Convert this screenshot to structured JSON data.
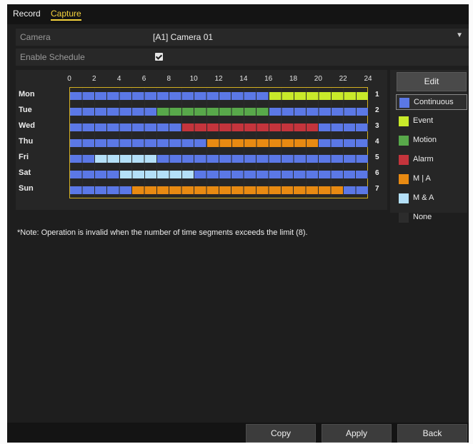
{
  "tabs": [
    {
      "label": "Record",
      "active": false
    },
    {
      "label": "Capture",
      "active": true
    }
  ],
  "camera": {
    "label": "Camera",
    "value": "[A1] Camera 01"
  },
  "enable_schedule": {
    "label": "Enable Schedule",
    "checked": true
  },
  "hours": [
    "0",
    "2",
    "4",
    "6",
    "8",
    "10",
    "12",
    "14",
    "16",
    "18",
    "20",
    "22",
    "24"
  ],
  "colors": {
    "continuous": "#5b78e6",
    "event": "#c8ea2a",
    "motion": "#58a84a",
    "alarm": "#c4343c",
    "mia": "#e88a12",
    "manda": "#b4e0f8",
    "none": "#2c2c2c"
  },
  "days": [
    {
      "name": "Mon",
      "num": "1",
      "segments": [
        {
          "start": 0,
          "end": 16,
          "type": "continuous"
        },
        {
          "start": 16,
          "end": 24,
          "type": "event"
        }
      ]
    },
    {
      "name": "Tue",
      "num": "2",
      "segments": [
        {
          "start": 0,
          "end": 7,
          "type": "continuous"
        },
        {
          "start": 7,
          "end": 16,
          "type": "motion"
        },
        {
          "start": 16,
          "end": 24,
          "type": "continuous"
        }
      ]
    },
    {
      "name": "Wed",
      "num": "3",
      "segments": [
        {
          "start": 0,
          "end": 9,
          "type": "continuous"
        },
        {
          "start": 9,
          "end": 20,
          "type": "alarm"
        },
        {
          "start": 20,
          "end": 24,
          "type": "continuous"
        }
      ]
    },
    {
      "name": "Thu",
      "num": "4",
      "segments": [
        {
          "start": 0,
          "end": 11,
          "type": "continuous"
        },
        {
          "start": 11,
          "end": 20,
          "type": "mia"
        },
        {
          "start": 20,
          "end": 24,
          "type": "continuous"
        }
      ]
    },
    {
      "name": "Fri",
      "num": "5",
      "segments": [
        {
          "start": 0,
          "end": 2,
          "type": "continuous"
        },
        {
          "start": 2,
          "end": 7,
          "type": "manda"
        },
        {
          "start": 7,
          "end": 24,
          "type": "continuous"
        }
      ]
    },
    {
      "name": "Sat",
      "num": "6",
      "segments": [
        {
          "start": 0,
          "end": 4,
          "type": "continuous"
        },
        {
          "start": 4,
          "end": 10,
          "type": "manda"
        },
        {
          "start": 10,
          "end": 24,
          "type": "continuous"
        }
      ]
    },
    {
      "name": "Sun",
      "num": "7",
      "segments": [
        {
          "start": 0,
          "end": 5,
          "type": "continuous"
        },
        {
          "start": 5,
          "end": 22,
          "type": "mia"
        },
        {
          "start": 22,
          "end": 24,
          "type": "continuous"
        }
      ]
    }
  ],
  "edit_label": "Edit",
  "legend": [
    {
      "key": "continuous",
      "label": "Continuous",
      "selected": true
    },
    {
      "key": "event",
      "label": "Event",
      "selected": false
    },
    {
      "key": "motion",
      "label": "Motion",
      "selected": false
    },
    {
      "key": "alarm",
      "label": "Alarm",
      "selected": false
    },
    {
      "key": "mia",
      "label": "M | A",
      "selected": false
    },
    {
      "key": "manda",
      "label": "M & A",
      "selected": false
    },
    {
      "key": "none",
      "label": "None",
      "selected": false
    }
  ],
  "note": "*Note: Operation is invalid when the number of time segments exceeds the limit (8).",
  "buttons": {
    "copy": "Copy",
    "apply": "Apply",
    "back": "Back"
  }
}
